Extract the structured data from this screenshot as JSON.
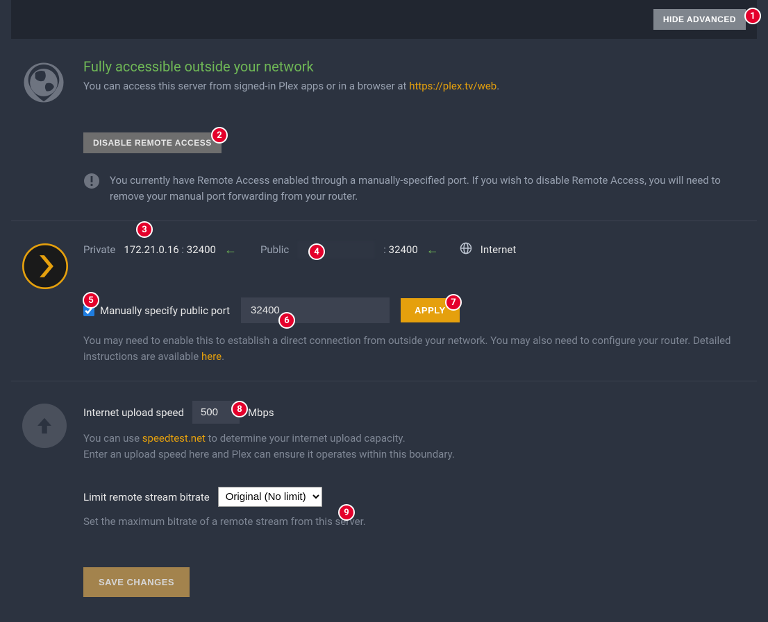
{
  "toolbar": {
    "hide_advanced": "HIDE ADVANCED"
  },
  "access": {
    "title": "Fully accessible outside your network",
    "desc_prefix": "You can access this server from signed-in Plex apps or in a browser at ",
    "desc_link": "https://plex.tv/web",
    "desc_suffix": ".",
    "disable_btn": "DISABLE REMOTE ACCESS",
    "notice": "You currently have Remote Access enabled through a manually-specified port. If you wish to disable Remote Access, you will need to remove your manual port forwarding from your router."
  },
  "net": {
    "private_label": "Private",
    "private_ip": "172.21.0.16",
    "private_port": "32400",
    "public_label": "Public",
    "public_port": "32400",
    "internet_label": "Internet",
    "manual_port_label": "Manually specify public port",
    "manual_port_value": "32400",
    "apply_btn": "APPLY",
    "help_prefix": "You may need to enable this to establish a direct connection from outside your network. You may also need to configure your router. Detailed instructions are available ",
    "help_link": "here",
    "help_suffix": "."
  },
  "upload": {
    "speed_label": "Internet upload speed",
    "speed_value": "500",
    "speed_unit": "Mbps",
    "help_prefix": "You can use ",
    "help_link": "speedtest.net",
    "help_suffix": " to determine your internet upload capacity.",
    "help_line2": "Enter an upload speed here and Plex can ensure it operates within this boundary.",
    "bitrate_label": "Limit remote stream bitrate",
    "bitrate_selected": "Original (No limit)",
    "bitrate_help": "Set the maximum bitrate of a remote stream from this server."
  },
  "save": {
    "label": "SAVE CHANGES"
  },
  "badges": [
    "1",
    "2",
    "3",
    "4",
    "5",
    "6",
    "7",
    "8",
    "9"
  ]
}
